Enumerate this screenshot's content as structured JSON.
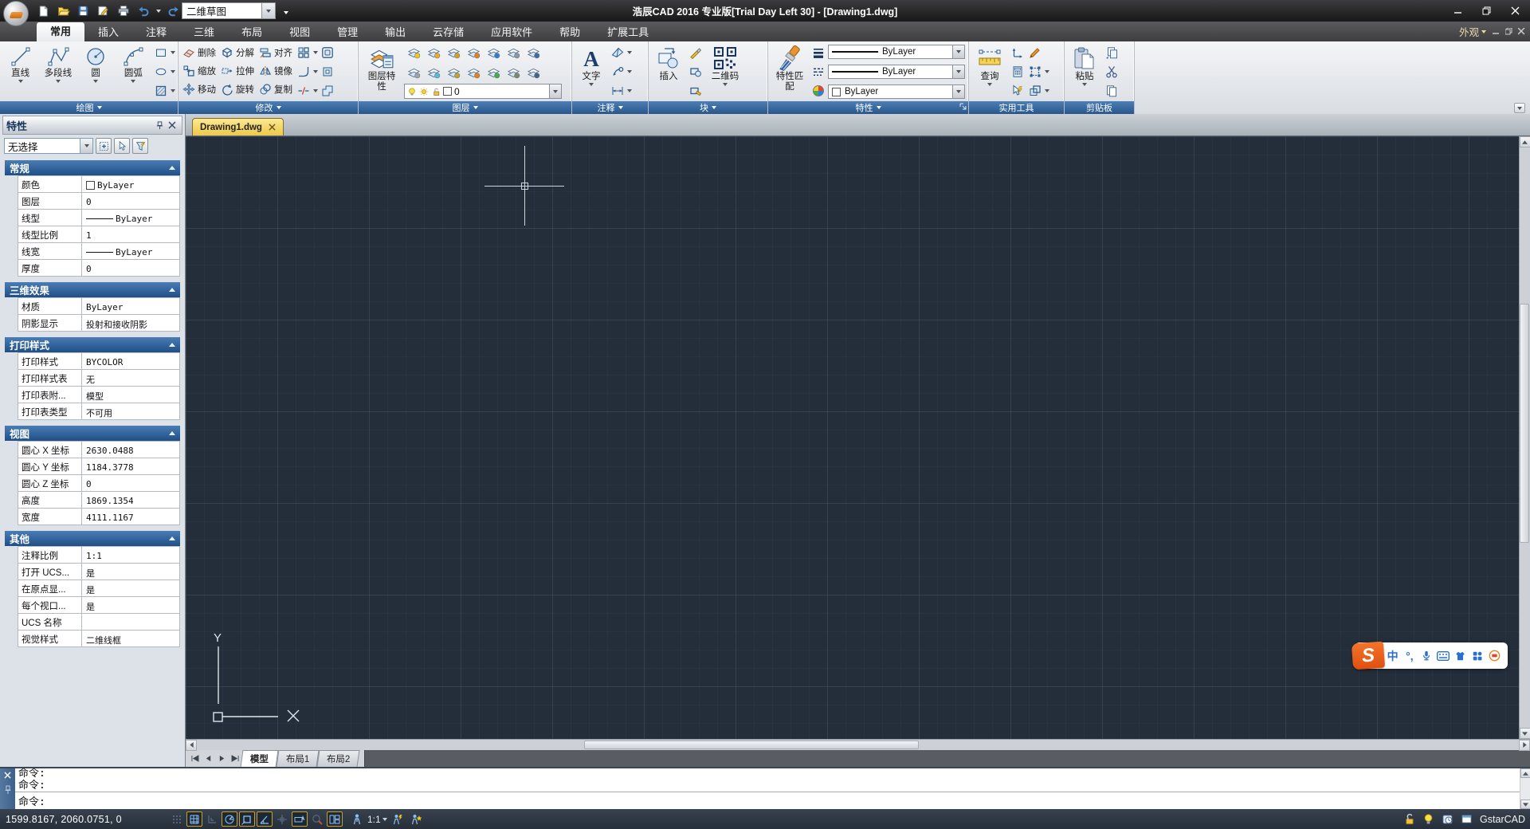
{
  "window": {
    "title": "浩辰CAD 2016 专业版[Trial Day Left 30] - [Drawing1.dwg]",
    "workspace": "二维草图",
    "appearance": "外观",
    "qat": [
      "new",
      "open",
      "save",
      "save-as",
      "plot",
      "undo",
      "redo"
    ]
  },
  "menu_tabs": [
    {
      "label": "常用",
      "active": true
    },
    {
      "label": "插入",
      "active": false
    },
    {
      "label": "注释",
      "active": false
    },
    {
      "label": "三维",
      "active": false
    },
    {
      "label": "布局",
      "active": false
    },
    {
      "label": "视图",
      "active": false
    },
    {
      "label": "管理",
      "active": false
    },
    {
      "label": "输出",
      "active": false
    },
    {
      "label": "云存储",
      "active": false
    },
    {
      "label": "应用软件",
      "active": false
    },
    {
      "label": "帮助",
      "active": false
    },
    {
      "label": "扩展工具",
      "active": false
    }
  ],
  "ribbon": {
    "panels": {
      "draw": {
        "title": "绘图",
        "big_buttons": [
          {
            "label": "直线",
            "icon": "line"
          },
          {
            "label": "多段线",
            "icon": "pline"
          },
          {
            "label": "圆",
            "icon": "circle"
          },
          {
            "label": "圆弧",
            "icon": "arc"
          }
        ],
        "small_tools": [
          "rect",
          "ellipse",
          "hatch"
        ]
      },
      "modify": {
        "title": "修改",
        "buttons": [
          {
            "label": "删除",
            "icon": "erase"
          },
          {
            "label": "分解",
            "icon": "explode"
          },
          {
            "label": "对齐",
            "icon": "align"
          },
          {
            "label": "缩放",
            "icon": "scale"
          },
          {
            "label": "拉伸",
            "icon": "stretch"
          },
          {
            "label": "镜像",
            "icon": "mirror"
          },
          {
            "label": "移动",
            "icon": "move"
          },
          {
            "label": "旋转",
            "icon": "rotate"
          },
          {
            "label": "复制",
            "icon": "copy"
          }
        ],
        "extra_tools": [
          "array",
          "fillet",
          "break"
        ],
        "corner_tools": [
          "offset",
          "region",
          "boundary"
        ]
      },
      "layer": {
        "title": "图层",
        "big_label": "图层特性",
        "combo_value": "0",
        "tools_row1": [
          "layer-on",
          "layer-thaw",
          "layer-unlock",
          "layer-isolate",
          "layer-unisolate",
          "layer-previous",
          "layer-states"
        ],
        "tools_row2": [
          "layer-off",
          "layer-freeze",
          "layer-lock",
          "layer-current",
          "layer-match",
          "layer-merge",
          "layer-delete"
        ]
      },
      "annotate": {
        "title": "注释",
        "big_label": "文字",
        "tools": [
          "dimplane",
          "leader",
          "dimension"
        ]
      },
      "block": {
        "title": "块",
        "insert_label": "插入",
        "qr_label": "二维码",
        "tools": [
          "attr-define",
          "attr-edit",
          "attr-manage"
        ]
      },
      "properties": {
        "title": "特性",
        "match_label": "特性匹配",
        "lineweight_value": "ByLayer",
        "linetype_value": "ByLayer",
        "color_value": "ByLayer",
        "side_tools": [
          "lineweight",
          "linetype",
          "colorwheel"
        ]
      },
      "utilities": {
        "title": "实用工具",
        "big_label": "查询",
        "tools": [
          "ucs",
          "calculator",
          "quick-select",
          "marker",
          "viewport-select",
          "overlap"
        ]
      },
      "clipboard": {
        "title": "剪贴板",
        "big_label": "粘贴",
        "tools": [
          "copy-base",
          "cut",
          "copy-clip"
        ]
      }
    }
  },
  "palette": {
    "title": "特性",
    "selection": "无选择",
    "sections": [
      {
        "title": "常规",
        "rows": [
          {
            "label": "颜色",
            "value": "ByLayer",
            "swatch": "colorbox"
          },
          {
            "label": "图层",
            "value": "0",
            "swatch": ""
          },
          {
            "label": "线型",
            "value": "ByLayer",
            "swatch": "line"
          },
          {
            "label": "线型比例",
            "value": "1",
            "swatch": ""
          },
          {
            "label": "线宽",
            "value": "ByLayer",
            "swatch": "line"
          },
          {
            "label": "厚度",
            "value": "0",
            "swatch": ""
          }
        ]
      },
      {
        "title": "三维效果",
        "rows": [
          {
            "label": "材质",
            "value": "ByLayer",
            "swatch": ""
          },
          {
            "label": "阴影显示",
            "value": "投射和接收阴影",
            "swatch": ""
          }
        ]
      },
      {
        "title": "打印样式",
        "rows": [
          {
            "label": "打印样式",
            "value": "BYCOLOR",
            "swatch": ""
          },
          {
            "label": "打印样式表",
            "value": "无",
            "swatch": ""
          },
          {
            "label": "打印表附...",
            "value": "模型",
            "swatch": ""
          },
          {
            "label": "打印表类型",
            "value": "不可用",
            "swatch": ""
          }
        ]
      },
      {
        "title": "视图",
        "rows": [
          {
            "label": "圆心 X 坐标",
            "value": "2630.0488",
            "swatch": ""
          },
          {
            "label": "圆心 Y 坐标",
            "value": "1184.3778",
            "swatch": ""
          },
          {
            "label": "圆心 Z 坐标",
            "value": "0",
            "swatch": ""
          },
          {
            "label": "高度",
            "value": "1869.1354",
            "swatch": ""
          },
          {
            "label": "宽度",
            "value": "4111.1167",
            "swatch": ""
          }
        ]
      },
      {
        "title": "其他",
        "rows": [
          {
            "label": "注释比例",
            "value": "1:1",
            "swatch": ""
          },
          {
            "label": "打开 UCS...",
            "value": "是",
            "swatch": ""
          },
          {
            "label": "在原点显...",
            "value": "是",
            "swatch": ""
          },
          {
            "label": "每个视口...",
            "value": "是",
            "swatch": ""
          },
          {
            "label": "UCS 名称",
            "value": "",
            "swatch": ""
          },
          {
            "label": "视觉样式",
            "value": "二维线框",
            "swatch": ""
          }
        ]
      }
    ]
  },
  "document": {
    "file_tab": "Drawing1.dwg",
    "layout_tabs": [
      {
        "label": "模型",
        "active": true
      },
      {
        "label": "布局1",
        "active": false
      },
      {
        "label": "布局2",
        "active": false
      }
    ]
  },
  "command": {
    "history": [
      "命令:",
      "命令:"
    ],
    "prompt": "命令:"
  },
  "statusbar": {
    "coordinates": "1599.8167, 2060.0751, 0",
    "toggles": [
      {
        "name": "snap",
        "active": false
      },
      {
        "name": "grid",
        "active": true
      },
      {
        "name": "ortho",
        "active": false
      },
      {
        "name": "polar",
        "active": true
      },
      {
        "name": "object-snap",
        "active": true
      },
      {
        "name": "object-track",
        "active": true
      },
      {
        "name": "crosshair",
        "active": false
      },
      {
        "name": "dynamic-input",
        "active": true
      },
      {
        "name": "magnifier",
        "active": false
      },
      {
        "name": "viewports",
        "active": true
      }
    ],
    "annotation_scale": "1:1",
    "brand": "GstarCAD"
  },
  "ime": {
    "mode_label": "中",
    "punct_label": "°,",
    "tools": [
      "mic",
      "keyboard",
      "skin",
      "toolbox",
      "emoji"
    ]
  },
  "colors": {
    "panel_title_blue": "#2a568a",
    "canvas_bg": "#232e3a",
    "active_tab_gold": "#edc84a",
    "accent_stroke": "#2e5f8f"
  }
}
